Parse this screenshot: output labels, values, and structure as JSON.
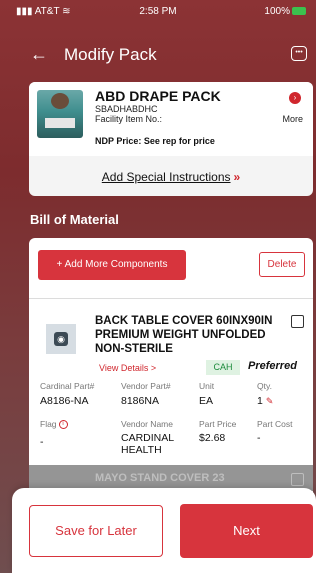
{
  "status_bar": {
    "carrier": "AT&T",
    "time": "2:58 PM",
    "battery": "100%"
  },
  "header": {
    "title": "Modify Pack"
  },
  "product": {
    "name": "ABD DRAPE PACK",
    "code": "SBADHABDHC",
    "facility_label": "Facility Item No.:",
    "price_label": "NDP Price: See rep for price",
    "more_label": "More",
    "special_instructions": "Add Special Instructions",
    "special_arrows": "»"
  },
  "bom": {
    "title": "Bill of Material",
    "add_label": "+ Add More Components",
    "delete_label": "Delete",
    "item": {
      "name": "BACK TABLE COVER 60INX90IN PREMIUM WEIGHT UNFOLDED NON-STERILE",
      "view_details": "View Details >",
      "badge": "CAH",
      "preferred": "Preferred",
      "cardinal_part_label": "Cardinal Part#",
      "cardinal_part": "A8186-NA",
      "vendor_part_label": "Vendor Part#",
      "vendor_part": "8186NA",
      "unit_label": "Unit",
      "unit": "EA",
      "qty_label": "Qty.",
      "qty": "1",
      "flag_label": "Flag",
      "flag": "-",
      "vendor_name_label": "Vendor Name",
      "vendor_name": "CARDINAL HEALTH",
      "part_price_label": "Part Price",
      "part_price": "$2.68",
      "part_cost_label": "Part Cost",
      "part_cost": "-"
    },
    "next_item_peek": "MAYO STAND COVER 23"
  },
  "footer": {
    "save_label": "Save for Later",
    "next_label": "Next"
  },
  "colors": {
    "brand_red": "#d7343d",
    "header_bg": "#8c3335",
    "preferred_badge_bg": "#dff2e2"
  },
  "icons": [
    "signal-icon",
    "wifi-icon",
    "battery-icon",
    "back-arrow-icon",
    "chat-icon",
    "info-icon",
    "pencil-icon",
    "checkbox-icon"
  ]
}
